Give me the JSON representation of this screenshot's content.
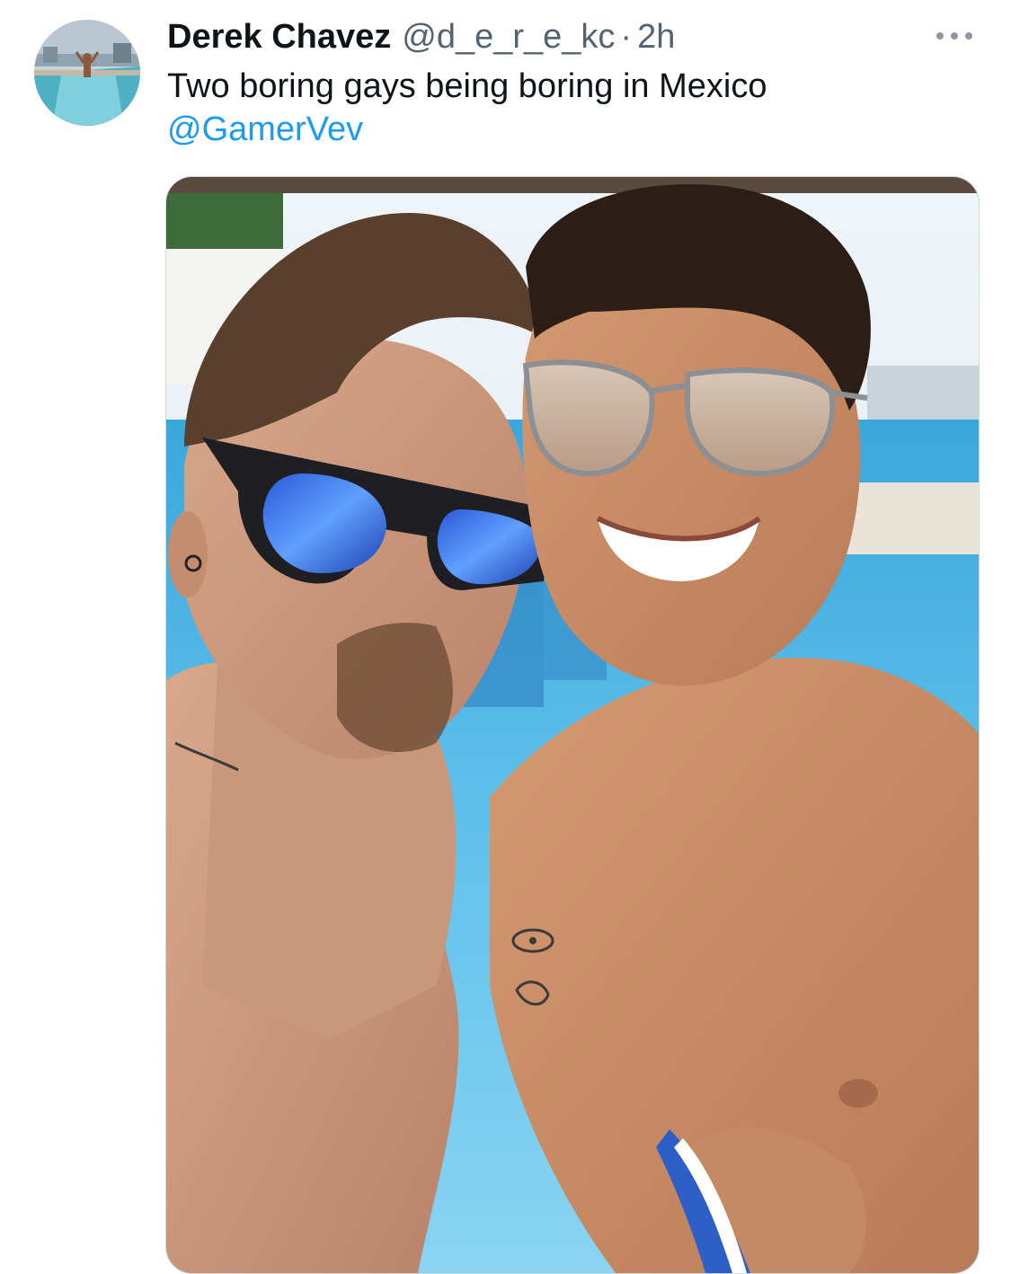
{
  "tweet": {
    "author": {
      "display_name": "Derek Chavez",
      "handle": "@d_e_r_e_kc",
      "separator": "·",
      "time": "2h"
    },
    "more_icon": "more-horizontal-icon",
    "text_line_1": "Two boring gays being boring in Mexico",
    "mention": "@GamerVev",
    "colors": {
      "text": "#0f1419",
      "secondary": "#536471",
      "link": "#1d9bf0",
      "border": "#cfd9de"
    }
  }
}
